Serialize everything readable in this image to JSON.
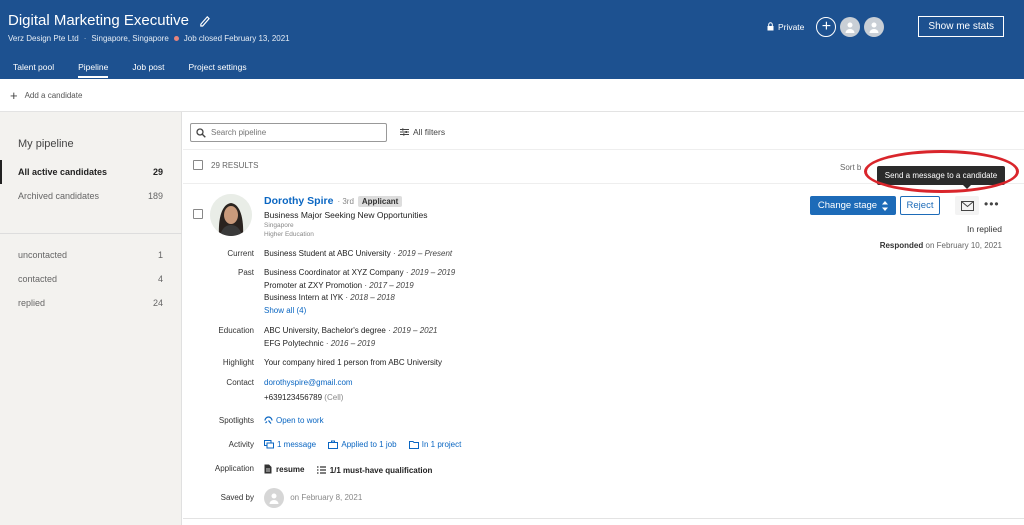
{
  "header": {
    "title": "Digital Marketing Executive",
    "company": "Verz Design Pte Ltd",
    "location": "Singapore, Singapore",
    "job_status": "Job closed February 13, 2021",
    "privacy": "Private",
    "stats_button": "Show me stats",
    "tabs": [
      "Talent pool",
      "Pipeline",
      "Job post",
      "Project settings"
    ],
    "active_tab": "Pipeline",
    "colors": {
      "header_bg": "#1d5190",
      "link": "#0a66c2",
      "closed_dot": "#e8847c",
      "highlight_ring": "#d9252b"
    }
  },
  "toolbar": {
    "add_candidate": "Add a candidate"
  },
  "sidebar": {
    "title": "My pipeline",
    "items": [
      {
        "label": "All active candidates",
        "count": "29"
      },
      {
        "label": "Archived candidates",
        "count": "189"
      },
      {
        "label": "uncontacted",
        "count": "1"
      },
      {
        "label": "contacted",
        "count": "4"
      },
      {
        "label": "replied",
        "count": "24"
      }
    ]
  },
  "search": {
    "placeholder": "Search pipeline",
    "filters_label": "All filters"
  },
  "results": {
    "count_label": "29 RESULTS",
    "sort_label": "Sort b"
  },
  "tooltip": "Send a message to a candidate",
  "candidate": {
    "name": "Dorothy Spire",
    "degree": "· 3rd",
    "badge": "Applicant",
    "headline": "Business Major Seeking New Opportunities",
    "location": "Singapore",
    "education_short": "Higher Education",
    "change_stage": "Change stage",
    "reject": "Reject",
    "status": "In replied",
    "responded_label": "Responded",
    "responded_date": "on February 10, 2021",
    "labels": {
      "current": "Current",
      "past": "Past",
      "education": "Education",
      "highlight": "Highlight",
      "contact": "Contact",
      "spotlights": "Spotlights",
      "activity": "Activity",
      "application": "Application",
      "saved_by": "Saved by"
    },
    "current": {
      "title": "Business Student at ABC University",
      "dates": "· 2019 – Present"
    },
    "past": [
      {
        "title": "Business Coordinator at XYZ Company",
        "dates": "· 2019 – 2019"
      },
      {
        "title": "Promoter at  ZXY Promotion",
        "dates": "· 2017 – 2019"
      },
      {
        "title": "Business Intern at IYK",
        "dates": "· 2018 – 2018"
      }
    ],
    "show_all": "Show all (4)",
    "education": [
      {
        "title": "ABC University, Bachelor's degree",
        "dates": "· 2019 – 2021"
      },
      {
        "title": "EFG Polytechnic",
        "dates": "· 2016 – 2019"
      }
    ],
    "highlight": "Your company hired 1 person from ABC University",
    "email": "dorothyspire@gmail.com",
    "phone": "+639123456789",
    "phone_type": "(Cell)",
    "spotlight": "Open to work",
    "activity": {
      "messages": "1 message",
      "applied": "Applied to 1 job",
      "projects": "In 1 project"
    },
    "application": {
      "resume": "resume",
      "qualification": "1/1 must-have qualification"
    },
    "saved_date": "on February 8, 2021"
  }
}
